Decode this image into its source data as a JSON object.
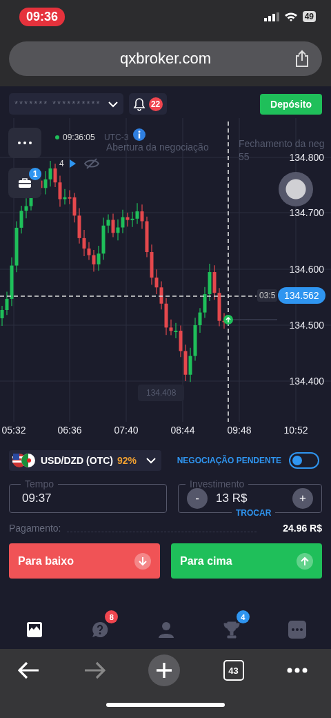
{
  "status_bar": {
    "time": "09:36",
    "battery": "49"
  },
  "browser": {
    "url": "qxbroker.com",
    "tab_count": "43"
  },
  "header": {
    "account_masked": "******* **********",
    "notifications": "22",
    "deposit_button": "Depósito"
  },
  "chart": {
    "clock": "09:36:05",
    "timezone": "UTC-3",
    "open_label": "Abertura da negociação",
    "close_label": "Fechamento da neg",
    "close_timer": "55",
    "trades_count": "4",
    "portfolio_badge": "1",
    "price_levels": [
      "134.800",
      "134.700",
      "134.600",
      "134.500",
      "134.400"
    ],
    "time_labels": [
      "05:32",
      "06:36",
      "07:40",
      "08:44",
      "09:48",
      "10:52"
    ],
    "countdown": "03:5",
    "current_price": "134.562",
    "low_label": "134.408"
  },
  "asset": {
    "name": "USD/DZD (OTC)",
    "payout": "92%"
  },
  "pending": {
    "label": "NEGOCIAÇÃO PENDENTE",
    "on": false
  },
  "time_field": {
    "label": "Tempo",
    "value": "09:37"
  },
  "investment": {
    "label": "Investimento",
    "value": "13 R$",
    "minus": "-",
    "plus": "+",
    "switch_label": "TROCAR"
  },
  "payout_row": {
    "label": "Pagamento:",
    "value": "24.96 R$"
  },
  "trade_buttons": [
    {
      "label": "Para baixo",
      "kind": "down"
    },
    {
      "label": "Para cima",
      "kind": "up"
    }
  ],
  "bottom_nav": [
    {
      "kind": "chart",
      "selected": true
    },
    {
      "kind": "help",
      "selected": false,
      "badge": "8",
      "color": "#f0464f"
    },
    {
      "kind": "profile",
      "selected": false
    },
    {
      "kind": "trophy",
      "selected": false,
      "badge": "4",
      "color": "#2f95f0"
    },
    {
      "kind": "more",
      "selected": false
    }
  ]
}
